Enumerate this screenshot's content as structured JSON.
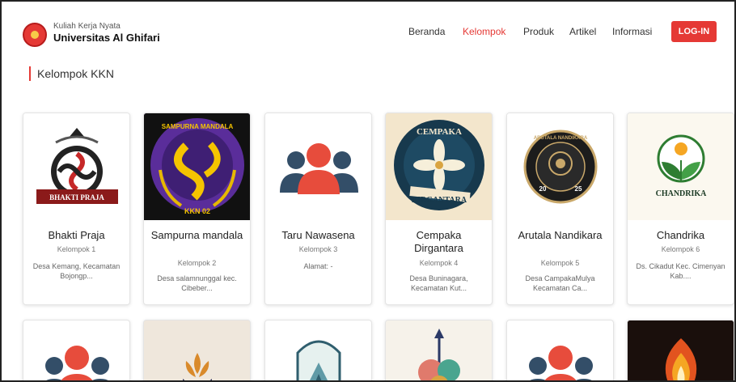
{
  "header": {
    "brand_sub": "Kuliah Kerja Nyata",
    "brand_main": "Universitas Al Ghifari",
    "nav": [
      "Beranda",
      "Kelompok",
      "Produk",
      "Artikel",
      "Informasi"
    ],
    "active_nav": "Kelompok",
    "login_label": "LOG-IN"
  },
  "section": {
    "title": "Kelompok KKN"
  },
  "cards": [
    {
      "name": "Bhakti Praja",
      "group": "Kelompok 1",
      "address": "Desa Kemang, Kecamatan Bojongp...",
      "logo_text": "BHAKTI PRAJA"
    },
    {
      "name": "Sampurna mandala",
      "group": "Kelompok 2",
      "address": "Desa salamnunggal kec. Cibeber...",
      "logo_text": "SAMPURNA MANDALA",
      "logo_sub": "KKN 02"
    },
    {
      "name": "Taru Nawasena",
      "group": "Kelompok 3",
      "address": "Alamat: -"
    },
    {
      "name": "Cempaka Dirgantara",
      "group": "Kelompok 4",
      "address": "Desa Buninagara, Kecamatan Kut...",
      "logo_text": "CEMPAKA",
      "logo_sub": "DIRGANTARA"
    },
    {
      "name": "Arutala Nandikara",
      "group": "Kelompok 5",
      "address": "Desa CampakaMulya Kecamatan Ca...",
      "logo_text": "ARUTALA NANDIKARA",
      "logo_year_left": "20",
      "logo_year_right": "25"
    },
    {
      "name": "Chandrika",
      "group": "Kelompok 6",
      "address": "Ds. Cikadut Kec. Cimenyan Kab....",
      "logo_text": "CHANDRIKA"
    }
  ],
  "colors": {
    "accent": "#e53935",
    "text": "#333333",
    "muted": "#777777"
  }
}
